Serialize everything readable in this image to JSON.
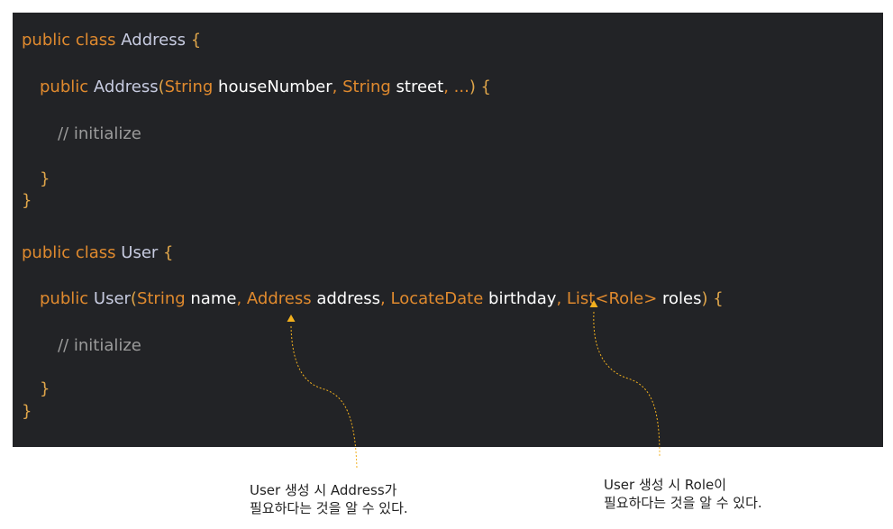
{
  "code": {
    "line1": {
      "kw": "public class ",
      "cls": "Address",
      "brace": " {"
    },
    "line2": {
      "kw1": "public ",
      "cls": "Address",
      "paren": "(",
      "t1": "String",
      "p1": " houseNumber",
      "c1": ", ",
      "t2": "String",
      "p2": " street",
      "c2": ", ",
      "ellipsis": "...",
      "close": ") {"
    },
    "line3": {
      "comment": "// initialize"
    },
    "line4": {
      "brace": "}"
    },
    "line5": {
      "brace": "}"
    },
    "line6": {
      "kw": "public class ",
      "cls": "User",
      "brace": " {"
    },
    "line7": {
      "kw1": "public ",
      "cls": "User",
      "paren": "(",
      "t1": "String",
      "p1": " name",
      "c1": ", ",
      "t2": "Address",
      "p2": " address",
      "c2": ", ",
      "t3": "LocateDate",
      "p3": " birthday",
      "c3": ", ",
      "t4": "List<Role>",
      "p4": " roles",
      "close": ") {"
    },
    "line8": {
      "comment": "// initialize"
    },
    "line9": {
      "brace": "}"
    },
    "line10": {
      "brace": "}"
    }
  },
  "annotations": {
    "address": {
      "line1": "User 생성 시 Address가",
      "line2": "필요하다는 것을 알 수 있다."
    },
    "role": {
      "line1": "User 생성 시 Role이",
      "line2": "필요하다는 것을 알 수 있다."
    }
  },
  "colors": {
    "background": "#222326",
    "keyword": "#e08a2e",
    "class_name": "#c7cbe0",
    "comment": "#9b9b9b",
    "arrow": "#f2b01e"
  }
}
